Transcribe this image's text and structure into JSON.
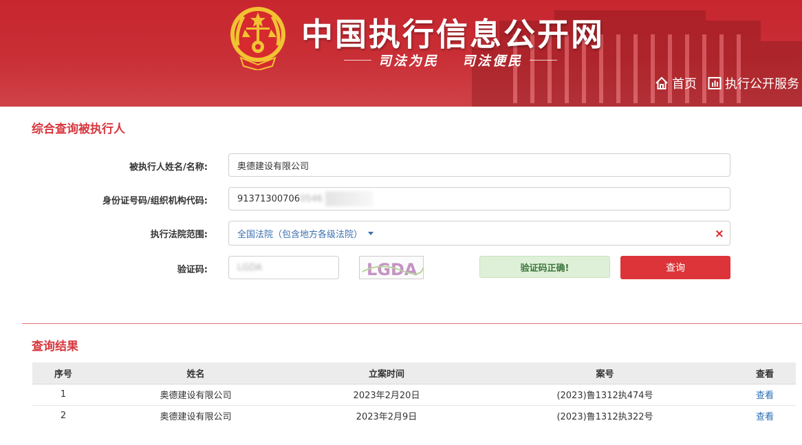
{
  "header": {
    "site_title": "中国执行信息公开网",
    "slogan_left": "司法为民",
    "slogan_right": "司法便民",
    "nav": {
      "home": "首页",
      "services": "执行公开服务"
    }
  },
  "query": {
    "title": "综合查询被执行人",
    "name_label": "被执行人姓名/名称:",
    "name_value": "奥德建设有限公司",
    "id_label": "身份证号码/组织机构代码:",
    "id_value": "91371300706",
    "id_value_masked": "0546",
    "court_label": "执行法院范围:",
    "court_value": "全国法院（包含地方各级法院）",
    "clear_icon": "×",
    "captcha_label": "验证码:",
    "captcha_value": "LGDA",
    "captcha_image_text": "LGDA",
    "captcha_status": "验证码正确!",
    "submit_label": "查询"
  },
  "results": {
    "title": "查询结果",
    "columns": [
      "序号",
      "姓名",
      "立案时间",
      "案号",
      "查看"
    ],
    "rows": [
      {
        "index": "1",
        "name": "奥德建设有限公司",
        "date": "2023年2月20日",
        "case": "(2023)鲁1312执474号",
        "view": "查看"
      },
      {
        "index": "2",
        "name": "奥德建设有限公司",
        "date": "2023年2月9日",
        "case": "(2023)鲁1312执322号",
        "view": "查看"
      }
    ]
  },
  "colors": {
    "brand_red": "#c8262f",
    "accent_red": "#d7363d",
    "button_red": "#dc3438",
    "link_blue": "#2a6db5",
    "success_bg": "#dff0d8"
  }
}
